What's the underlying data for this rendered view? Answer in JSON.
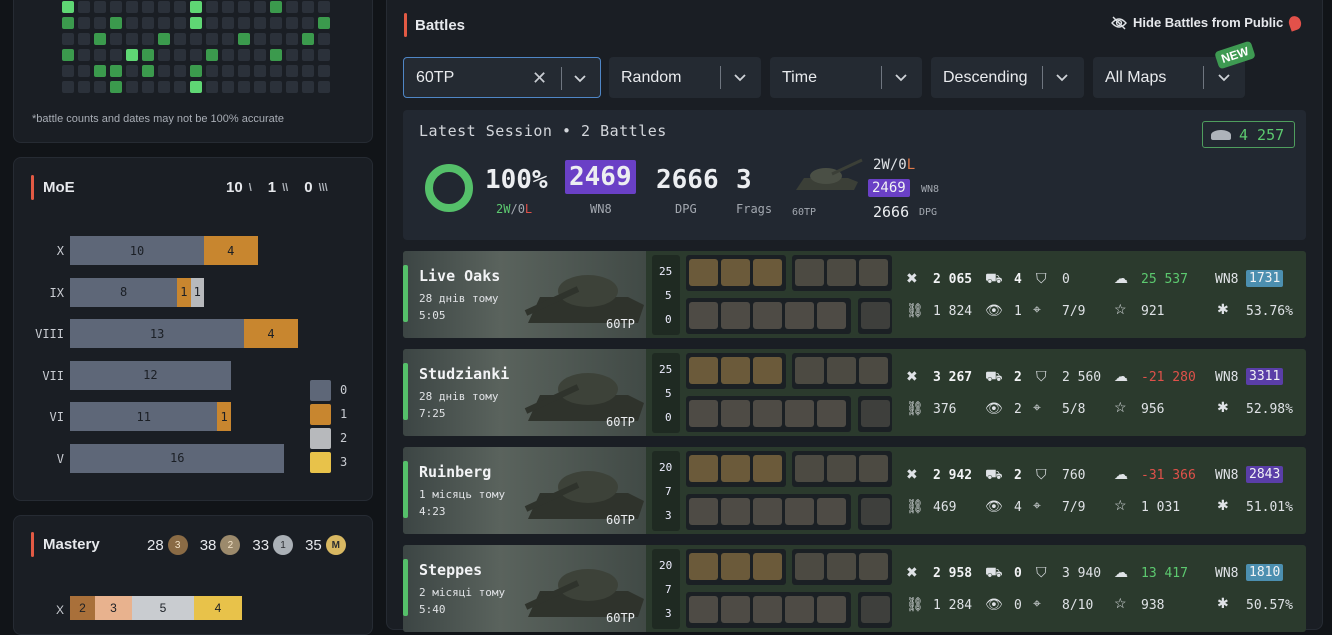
{
  "heatmap_note": "*battle counts and dates may not be 100% accurate",
  "moe": {
    "title": "MoE",
    "counts": [
      "10",
      "1",
      "0"
    ],
    "marks": [
      "\\",
      "\\\\",
      "\\\\\\"
    ]
  },
  "chart_data": {
    "type": "bar",
    "stacked": true,
    "orientation": "horizontal",
    "categories": [
      "X",
      "IX",
      "VIII",
      "VII",
      "VI",
      "V"
    ],
    "series": [
      {
        "name": "0",
        "color": "#5e6778",
        "values": [
          10,
          8,
          13,
          12,
          11,
          16
        ]
      },
      {
        "name": "1",
        "color": "#c8862f",
        "values": [
          4,
          1,
          4,
          0,
          1,
          0
        ]
      },
      {
        "name": "2",
        "color": "#b7b9bc",
        "values": [
          0,
          1,
          0,
          0,
          0,
          0
        ]
      },
      {
        "name": "3",
        "color": "#e8c24a",
        "values": [
          0,
          0,
          0,
          0,
          0,
          0
        ]
      }
    ],
    "legend": "right"
  },
  "mastery": {
    "title": "Mastery",
    "counts": [
      "28",
      "38",
      "33",
      "35"
    ],
    "badges": [
      "3",
      "2",
      "1",
      "M"
    ],
    "x_row": {
      "label": "X",
      "values": [
        "2",
        "3",
        "5",
        "4"
      ]
    }
  },
  "battles": {
    "title": "Battles",
    "hide_label": "Hide Battles from Public",
    "new_badge": "NEW",
    "filters": [
      {
        "value": "60TP",
        "clearable": true
      },
      {
        "value": "Random"
      },
      {
        "value": "Time"
      },
      {
        "value": "Descending"
      },
      {
        "value": "All Maps"
      }
    ]
  },
  "session": {
    "title": "Latest Session • 2 Battles",
    "credits": "4 257",
    "winrate": "100%",
    "wl_w": "2W",
    "wl_sep": "/",
    "wl_l_num": "0",
    "wl_l": "L",
    "wn8": "2469",
    "wn8_label": "WN8",
    "dpg": "2666",
    "dpg_label": "DPG",
    "frags": "3",
    "frags_label": "Frags",
    "tank": "60TP",
    "tank_wl_w": "2W",
    "tank_wl_sep": "/",
    "tank_wl_l_num": "0",
    "tank_wl_l": "L",
    "tank_wn8": "2469",
    "tank_wn8_label": "WN8",
    "tank_dpg": "2666",
    "tank_dpg_label": "DPG"
  },
  "rows": [
    {
      "map": "Live Oaks",
      "when": "28 днів тому",
      "dur": "5:05",
      "tank": "60TP",
      "ach": [
        "25",
        "5",
        "0"
      ],
      "dmg": "2 065",
      "spots": "4",
      "blocked": "0",
      "credits": "25 537",
      "credits_color": "#5cc96f",
      "assist": "1 824",
      "spotted": "1",
      "hits": "7/9",
      "xp": "921",
      "wn8": "1731",
      "wn8_color": "#4c8fb0",
      "pct": "53.76%"
    },
    {
      "map": "Studzianki",
      "when": "28 днів тому",
      "dur": "7:25",
      "tank": "60TP",
      "ach": [
        "25",
        "5",
        "0"
      ],
      "dmg": "3 267",
      "spots": "2",
      "blocked": "2 560",
      "credits": "-21 280",
      "credits_color": "#e0514a",
      "assist": "376",
      "spotted": "2",
      "hits": "5/8",
      "xp": "956",
      "wn8": "3311",
      "wn8_color": "#5a3ea8",
      "pct": "52.98%"
    },
    {
      "map": "Ruinberg",
      "when": "1 місяць тому",
      "dur": "4:23",
      "tank": "60TP",
      "ach": [
        "20",
        "7",
        "3"
      ],
      "dmg": "2 942",
      "spots": "2",
      "blocked": "760",
      "credits": "-31 366",
      "credits_color": "#e0514a",
      "assist": "469",
      "spotted": "4",
      "hits": "7/9",
      "xp": "1 031",
      "wn8": "2843",
      "wn8_color": "#5a3ea8",
      "pct": "51.01%"
    },
    {
      "map": "Steppes",
      "when": "2 місяці тому",
      "dur": "5:40",
      "tank": "60TP",
      "ach": [
        "20",
        "7",
        "3"
      ],
      "dmg": "2 958",
      "spots": "0",
      "blocked": "3 940",
      "credits": "13 417",
      "credits_color": "#5cc96f",
      "assist": "1 284",
      "spotted": "0",
      "hits": "8/10",
      "xp": "938",
      "wn8": "1810",
      "wn8_color": "#4c8fb0",
      "pct": "50.57%"
    }
  ]
}
